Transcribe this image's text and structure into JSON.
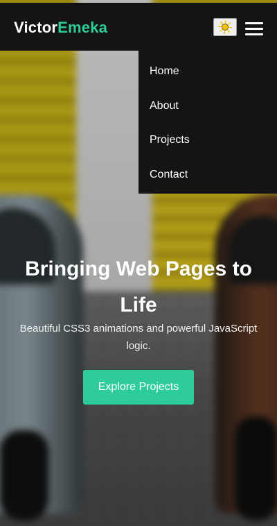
{
  "navbar": {
    "logo_first": "Victor",
    "logo_last": "Emeka",
    "theme_toggle_icon": "sun-icon",
    "menu_icon": "hamburger-menu-icon"
  },
  "menu": {
    "items": [
      {
        "label": "Home"
      },
      {
        "label": "About"
      },
      {
        "label": "Projects"
      },
      {
        "label": "Contact"
      }
    ]
  },
  "hero": {
    "title": "Bringing Web Pages to Life",
    "subtitle": "Beautiful CSS3 animations and powerful JavaScript logic.",
    "cta_label": "Explore Projects"
  },
  "colors": {
    "accent": "#2ecc9a",
    "navbar_bg": "#141414",
    "text": "#ffffff"
  }
}
